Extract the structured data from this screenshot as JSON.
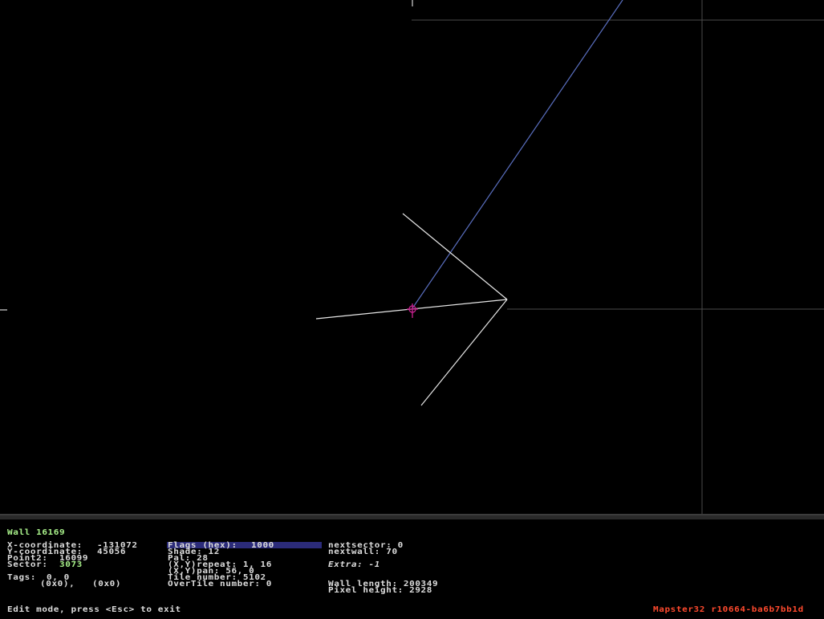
{
  "editor": {
    "header": "Wall 16169",
    "fields": {
      "x_label": "X-coordinate:",
      "x_value": "-131072",
      "y_label": "Y-coordinate:",
      "y_value": "45056",
      "point2_label": "Point2:",
      "point2_value": "16099",
      "sector_label": "Sector:",
      "sector_value": "3073",
      "tags_label": "Tags:",
      "tags_value": "0, 0",
      "tags_hex": "(0x0),   (0x0)"
    },
    "mid": {
      "flags_label": "Flags (hex):",
      "flags_value": "1000",
      "shade": "Shade: 12",
      "pal": "Pal: 28",
      "repeat": "(X,Y)repeat: 1, 16",
      "pan": "(X,Y)pan: 56, 0",
      "tile": "Tile number: 5102",
      "overtile": "OverTile number: 0"
    },
    "right": {
      "nextsector": "nextsector: 0",
      "nextwall": "nextwall: 70",
      "extra": "Extra: -1",
      "wall_length": "Wall length: 200349",
      "pixel_height": "Pixel height: 2928"
    },
    "status": "Edit mode, press <Esc> to exit",
    "version": "Mapster32 r10664-ba6b7bb1d"
  },
  "colors": {
    "wall": "#e6e6e6",
    "grid": "#4a4a4a",
    "sprite_line": "#5a6fc0",
    "cursor": "#c0208a",
    "header_green": "#a8f08a",
    "version_orange": "#ff4a2e",
    "highlight": "#2b2b7a"
  }
}
